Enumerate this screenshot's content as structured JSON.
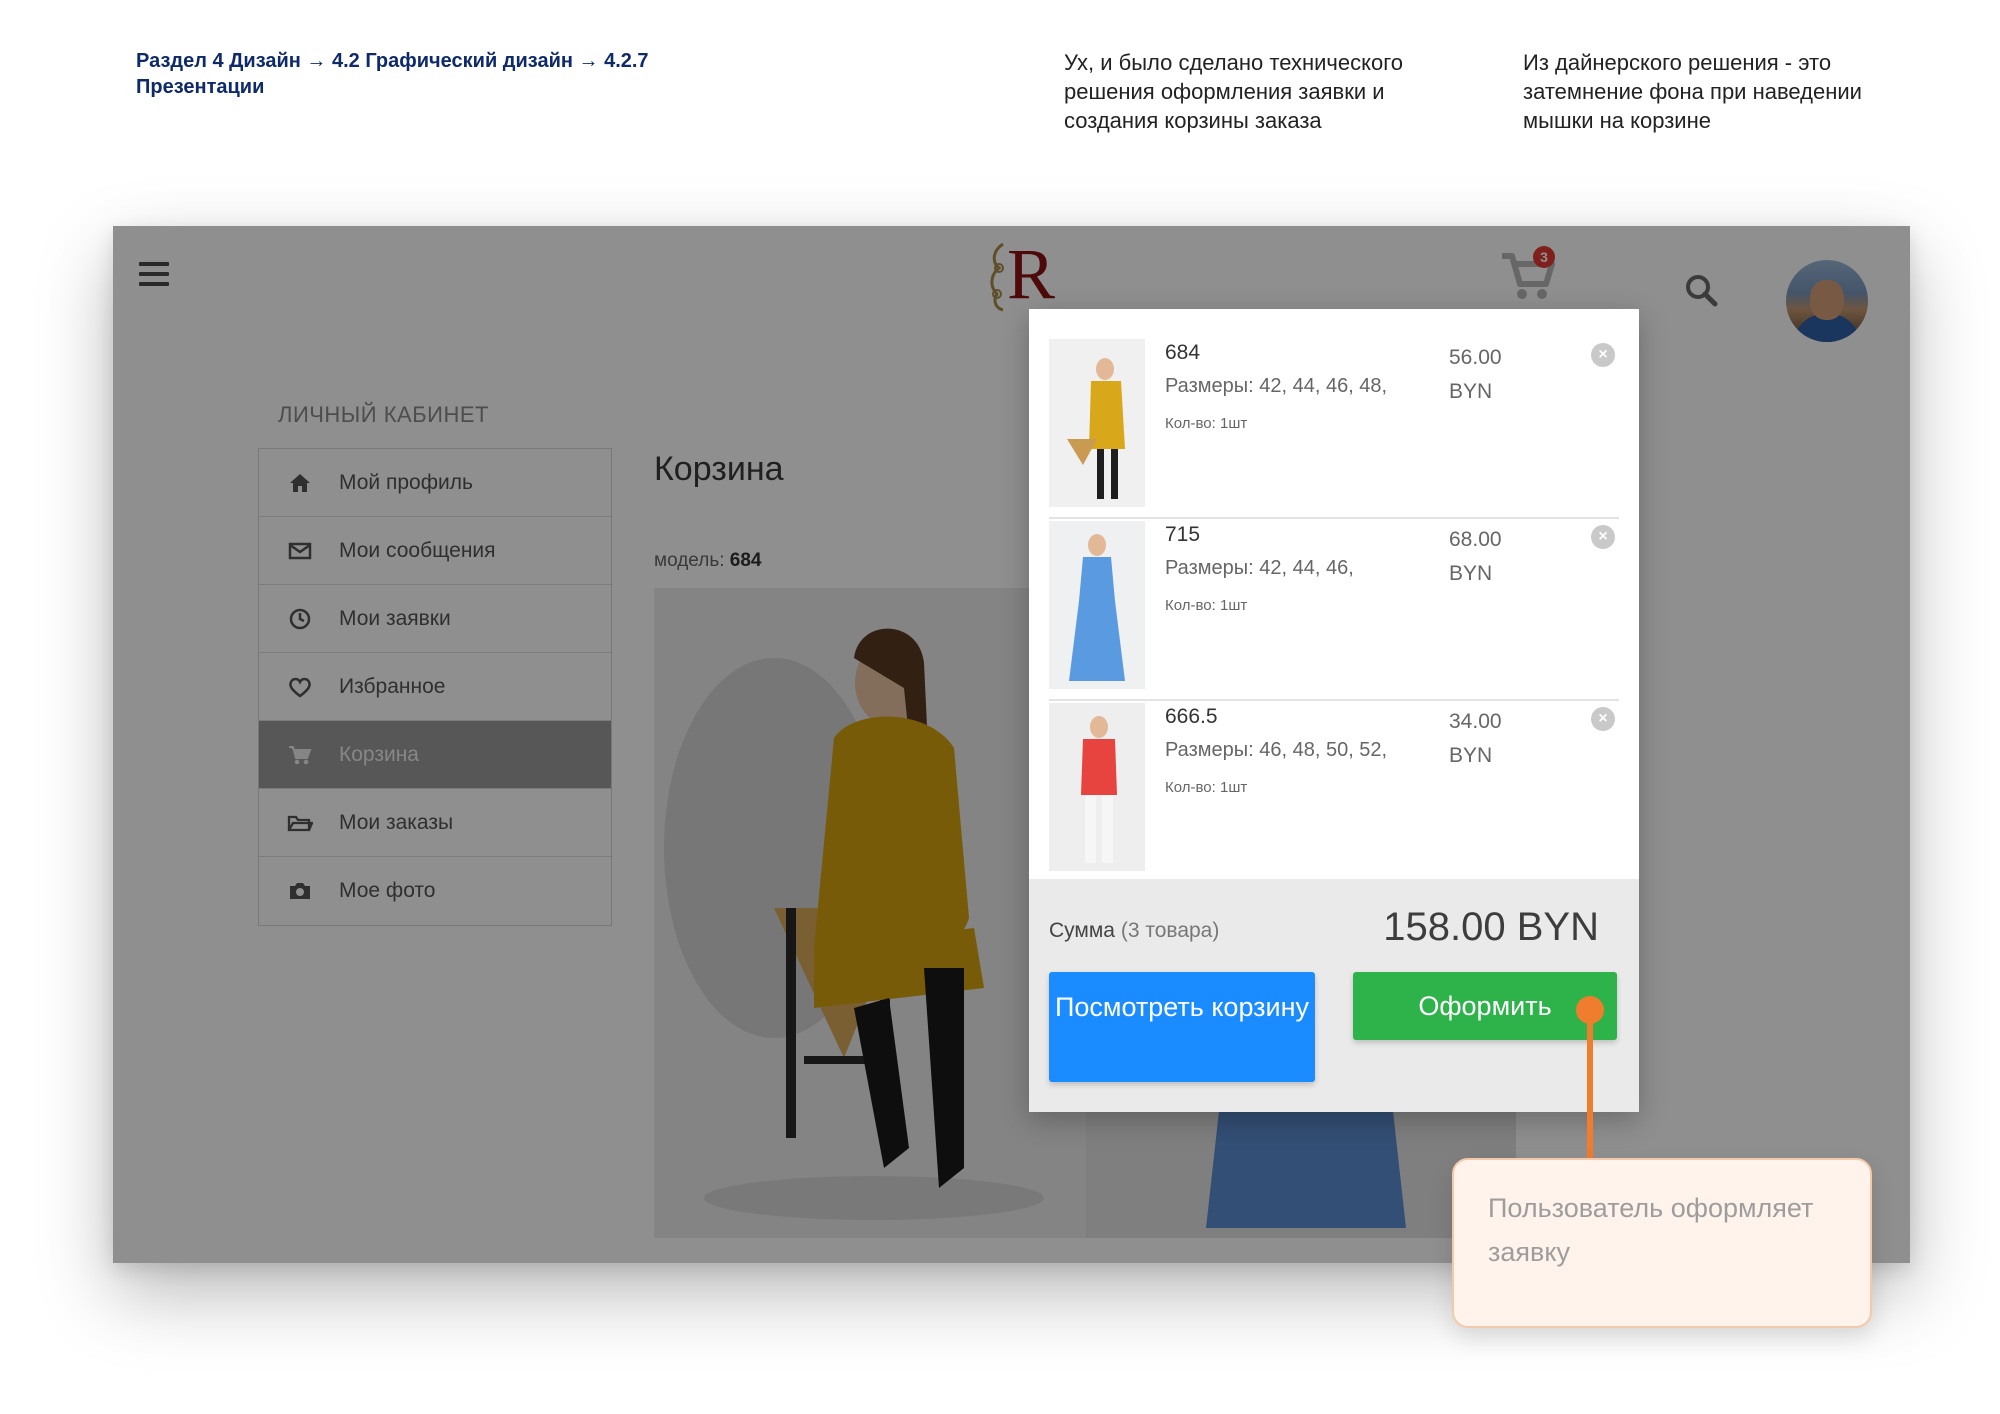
{
  "slide": {
    "breadcrumb": "Раздел 4 Дизайн  → 4.2 Графический дизайн → 4.2.7 Презентации",
    "note_left": "Ух, и было сделано технического решения оформления заявки и создания корзины заказа",
    "note_right": "Из дайнерского решения - это затемнение фона при наведении мышки на корзине",
    "callout": "Пользователь оформляет заявку"
  },
  "header": {
    "logo_letter": "R",
    "cart_badge": "3",
    "icons": [
      "menu-icon",
      "cart-icon",
      "search-icon"
    ]
  },
  "sidebar": {
    "title": "ЛИЧНЫЙ КАБИНЕТ",
    "items": [
      {
        "label": "Мой профиль",
        "icon": "home-icon"
      },
      {
        "label": "Мои сообщения",
        "icon": "envelope-icon"
      },
      {
        "label": "Мои заявки",
        "icon": "clock-icon"
      },
      {
        "label": "Избранное",
        "icon": "heart-icon"
      },
      {
        "label": "Корзина",
        "icon": "cart-icon",
        "active": true
      },
      {
        "label": "Мои заказы",
        "icon": "folder-icon"
      },
      {
        "label": "Мое фото",
        "icon": "camera-icon"
      }
    ]
  },
  "main": {
    "title": "Корзина",
    "model_label": "модель:",
    "model_value": "684"
  },
  "cart": {
    "items": [
      {
        "name": "684",
        "sizes": "Размеры: 42, 44, 46, 48,",
        "qty": "Кол-во: 1шт",
        "price": "56.00",
        "currency": "BYN",
        "color": "#d9a81a"
      },
      {
        "name": "715",
        "sizes": "Размеры: 42, 44, 46,",
        "qty": "Кол-во: 1шт",
        "price": "68.00",
        "currency": "BYN",
        "color": "#5a9ae0"
      },
      {
        "name": "666.5",
        "sizes": "Размеры: 46, 48, 50, 52,",
        "qty": "Кол-во: 1шт",
        "price": "34.00",
        "currency": "BYN",
        "color": "#e8443f"
      }
    ],
    "sum_label": "Сумма",
    "sum_count": "(3 товара)",
    "sum_total": "158.00 BYN",
    "view_button": "Посмотреть корзину",
    "order_button": "Оформить"
  },
  "colors": {
    "accent_blue": "#1a8cff",
    "accent_green": "#2db34a",
    "annotation_orange": "#f07c2d",
    "badge_red": "#e53935"
  }
}
